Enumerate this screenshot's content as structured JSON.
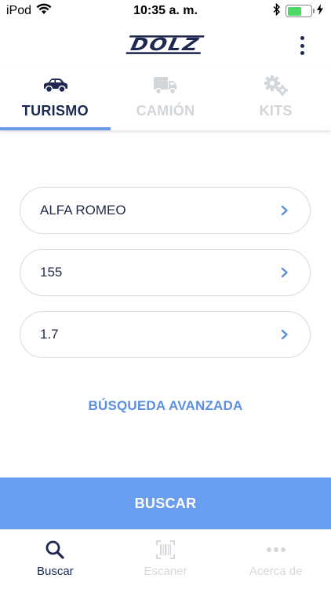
{
  "status_bar": {
    "carrier": "iPod",
    "time": "10:35 a. m.",
    "battery_level": 0.6,
    "icons": [
      "wifi-icon",
      "bluetooth-icon",
      "battery-icon",
      "charging-icon"
    ]
  },
  "header": {
    "logo_text": "DOLZ",
    "menu_icon": "kebab-menu-icon"
  },
  "tabs": [
    {
      "label": "TURISMO",
      "icon": "car-icon",
      "active": true
    },
    {
      "label": "CAMIÓN",
      "icon": "truck-icon",
      "active": false
    },
    {
      "label": "KITS",
      "icon": "gears-icon",
      "active": false
    }
  ],
  "fields": [
    {
      "value": "ALFA ROMEO",
      "icon": "chevron-right-icon"
    },
    {
      "value": "155",
      "icon": "chevron-right-icon"
    },
    {
      "value": "1.7",
      "icon": "chevron-right-icon"
    }
  ],
  "advanced_search_label": "BÚSQUEDA AVANZADA",
  "search_button_label": "BUSCAR",
  "bottom_nav": [
    {
      "label": "Buscar",
      "icon": "search-icon",
      "active": true
    },
    {
      "label": "Escaner",
      "icon": "barcode-scanner-icon",
      "active": false
    },
    {
      "label": "Acerca de",
      "icon": "more-dots-icon",
      "active": false
    }
  ],
  "colors": {
    "accent": "#6a9ef0",
    "link": "#5b8fe0",
    "brand_dark": "#1c2850",
    "inactive": "#d2d5da",
    "battery": "#4cd964"
  }
}
